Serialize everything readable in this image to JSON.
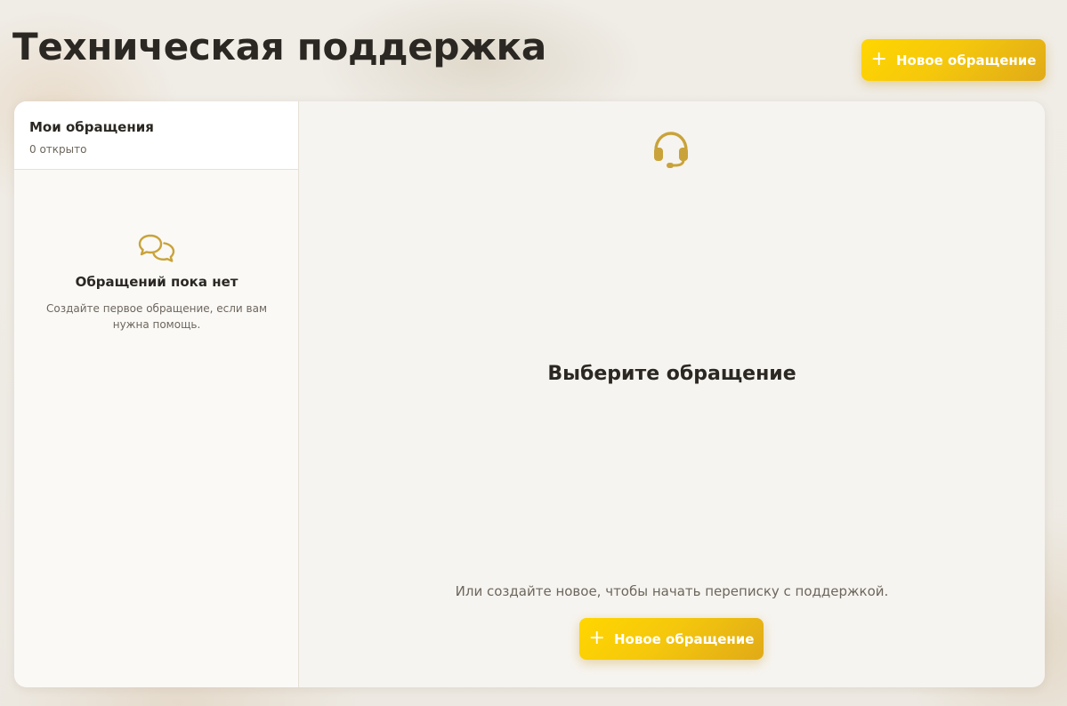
{
  "page": {
    "title": "Техническая поддержка"
  },
  "header": {
    "new_ticket_label": "Новое обращение"
  },
  "sidebar": {
    "title": "Мои обращения",
    "count_text": "0 открыто",
    "empty_title": "Обращений пока нет",
    "empty_description": "Создайте первое обращение, если вам нужна помощь."
  },
  "main": {
    "title": "Выберите обращение",
    "hint": "Или создайте новое, чтобы начать переписку с поддержкой.",
    "new_ticket_label": "Новое обращение"
  },
  "icons": {
    "add": "plus-icon",
    "chat": "chat-bubbles-icon",
    "support": "headset-icon"
  },
  "colors": {
    "accent": "#f5c80c",
    "accent_dark": "#e0aa18",
    "icon": "#c9a33a",
    "text": "#2b2722",
    "muted": "#6d665c"
  }
}
